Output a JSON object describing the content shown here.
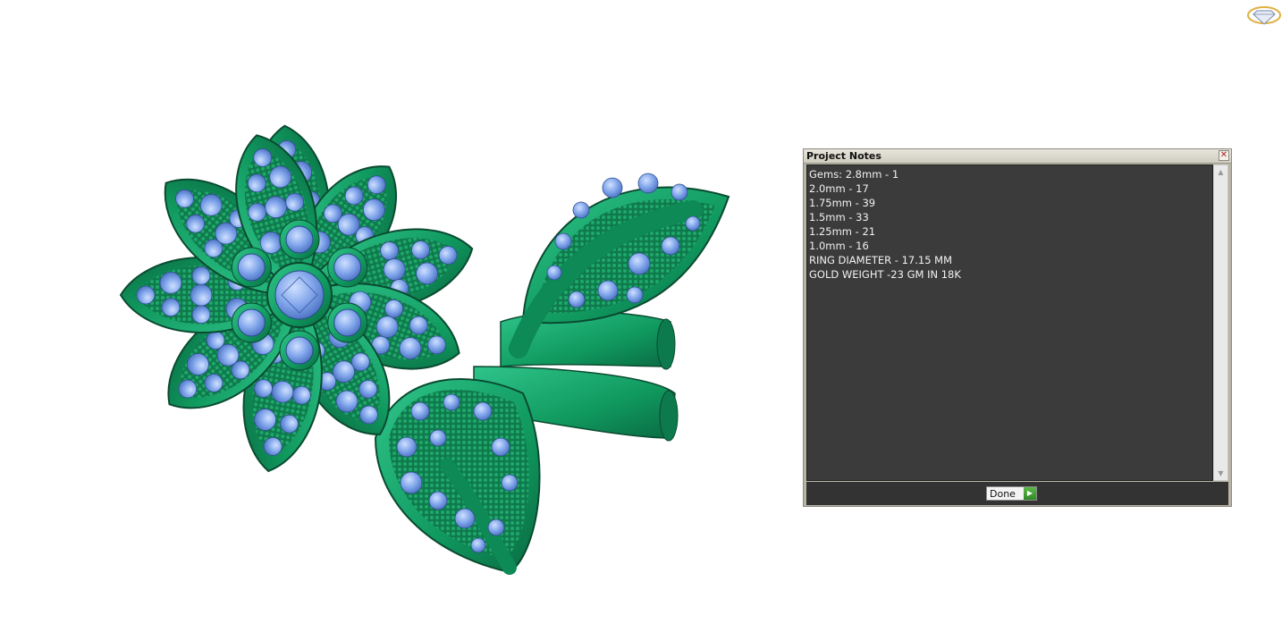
{
  "dialog": {
    "title": "Project Notes",
    "close_icon": "✕",
    "lines": [
      "Gems: 2.8mm - 1",
      "2.0mm - 17",
      "1.75mm - 39",
      "1.5mm - 33",
      "1.25mm - 21",
      "1.0mm - 16",
      "RING DIAMETER - 17.15 MM",
      "GOLD WEIGHT -23 GM IN 18K"
    ],
    "done_label": "Done",
    "done_icon": "play-arrow-icon",
    "scroll_up_icon": "▲",
    "scroll_down_icon": "▼"
  },
  "colors": {
    "metal": "#13a06a",
    "metal_dark": "#0a5a3a",
    "gem": "#7aa0e8",
    "gem_light": "#a8c6f5",
    "dialog_bg": "#3b3b3b"
  }
}
